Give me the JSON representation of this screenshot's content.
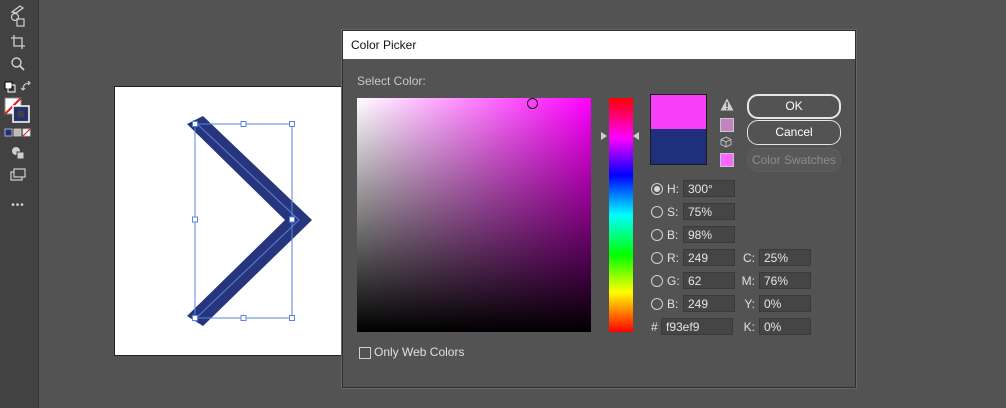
{
  "toolbar": {
    "icons": [
      "eyedropper-icon",
      "shape-builder-icon",
      "artboard-icon",
      "zoom-icon",
      "default-colors-icon",
      "swap-colors-icon",
      "fill-stroke-icon",
      "color-mode-icon",
      "draw-mode-icon",
      "screen-mode-icon",
      "more-tools-icon"
    ],
    "more_label": "•••"
  },
  "dialog": {
    "title": "Color Picker",
    "select_color_label": "Select Color:",
    "ok_label": "OK",
    "cancel_label": "Cancel",
    "swatches_label": "Color Swatches",
    "only_web_label": "Only Web Colors",
    "new_color": "#f93ef9",
    "old_color": "#1f2f7c",
    "hue_color": "#ff00ff",
    "fields": {
      "H": "300°",
      "S": "75%",
      "Bv": "98%",
      "R": "249",
      "G": "62",
      "Bc": "249",
      "hex": "f93ef9",
      "C": "25%",
      "M": "76%",
      "Y": "0%",
      "K": "0%"
    },
    "labels": {
      "H": "H:",
      "S": "S:",
      "Bv": "B:",
      "R": "R:",
      "G": "G:",
      "Bc": "B:",
      "hash": "#",
      "C": "C:",
      "M": "M:",
      "Y": "Y:",
      "K": "K:"
    }
  },
  "artwork": {
    "chevron_color": "#26357c",
    "selection_color": "#5b82e0"
  }
}
